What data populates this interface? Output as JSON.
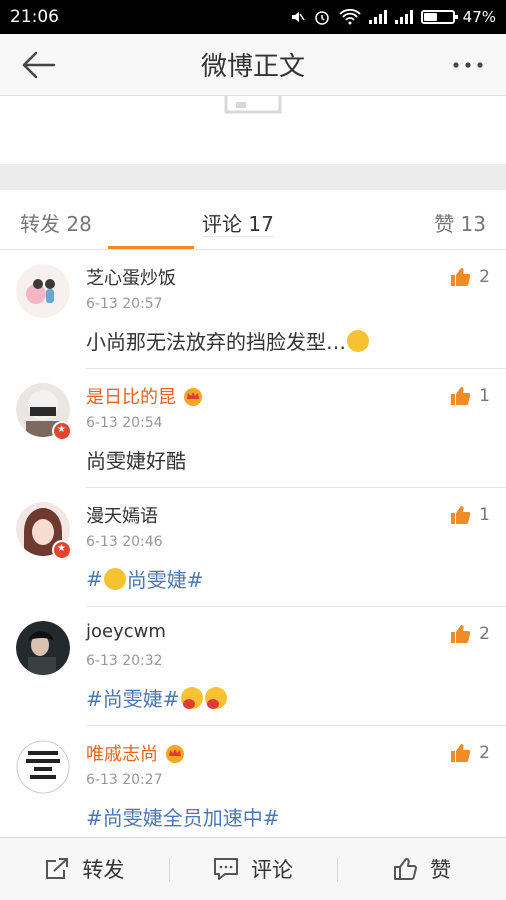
{
  "status": {
    "time": "21:06",
    "battery": "47%",
    "battery_level": 0.47,
    "icons": [
      "mute-icon",
      "alarm-icon",
      "wifi-icon",
      "signal-icon",
      "signal-icon",
      "battery-icon"
    ]
  },
  "header": {
    "title": "微博正文",
    "back_icon": "back-arrow-icon",
    "more_icon": "more-dots-icon"
  },
  "tabs": {
    "repost": "转发 28",
    "comment": "评论 17",
    "like": "赞 13",
    "active": "comment",
    "accent": "#f08c28"
  },
  "comments": [
    {
      "name": "芝心蛋炒饭",
      "time": "6-13 20:57",
      "text": "小尚那无法放弃的挡脸发型…",
      "likes": "2",
      "vip": false,
      "verified": false,
      "topic": false,
      "avatar_text": ""
    },
    {
      "name": "是日比的昆",
      "time": "6-13 20:54",
      "text": "尚雯婕好酷",
      "likes": "1",
      "vip": true,
      "verified": true,
      "topic": false,
      "avatar_text": ""
    },
    {
      "name": "漫天嫣语",
      "time": "6-13 20:46",
      "text_pre": "#",
      "text_post": "尚雯婕#",
      "likes": "1",
      "vip": false,
      "verified": true,
      "topic": true,
      "avatar_text": ""
    },
    {
      "name": "joeycwm",
      "time": "6-13 20:32",
      "text": "#尚雯婕#",
      "likes": "2",
      "vip": false,
      "verified": false,
      "topic": true,
      "avatar_text": ""
    },
    {
      "name": "唯戚志尚",
      "time": "6-13 20:27",
      "text": "#尚雯婕全员加速中#",
      "likes": "2",
      "vip": true,
      "verified": false,
      "topic": true,
      "avatar_text": "尚雯婕\n不发专辑\n我不\n换头像"
    }
  ],
  "bottom": {
    "repost": "转发",
    "comment": "评论",
    "like": "赞"
  },
  "colors": {
    "vip_name": "#e8651f",
    "topic": "#4b78b6",
    "like_icon": "#f08c28"
  }
}
